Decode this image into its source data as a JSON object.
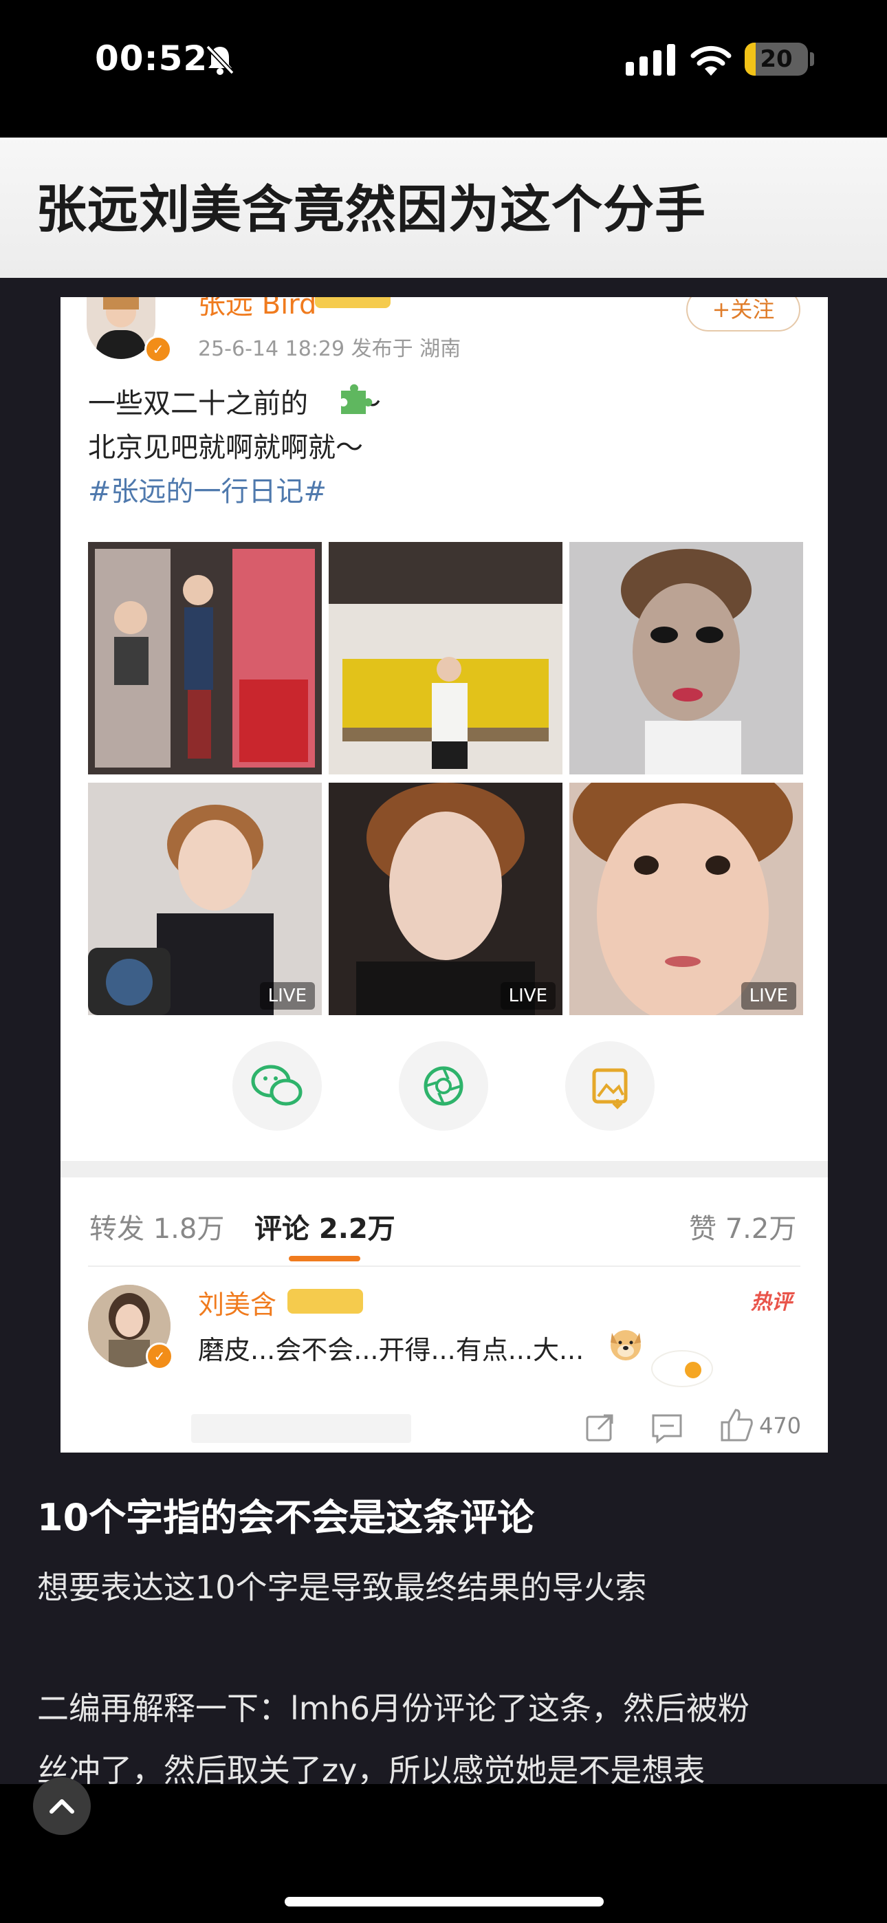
{
  "status_bar": {
    "time": "00:52",
    "battery": "20",
    "battery_level": 0.2
  },
  "page": {
    "title": "张远刘美含竟然因为这个分手"
  },
  "post": {
    "author": "张远 Bird",
    "meta": "25-6-14 18:29  发布于 湖南",
    "follow_label": "+关注",
    "line1": "一些双二十之前的",
    "line1_suffix": "～",
    "line2": "北京见吧就啊就啊就～",
    "hashtag": "#张远的一行日记#",
    "live_label": "LIVE",
    "stats": {
      "repost": "转发 1.8万",
      "comment": "评论 2.2万",
      "like": "赞 7.2万"
    }
  },
  "comment": {
    "author": "刘美含",
    "hot_label": "热评",
    "text": "磨皮...会不会...开得...有点...大...",
    "like_count": "470"
  },
  "article": {
    "heading": "10个字指的会不会是这条评论",
    "p1": "想要表达这10个字是导致最终结果的导火索",
    "p2_line1": "二编再解释一下：lmh6月份评论了这条，然后被粉",
    "p2_line2": "丝冲了，然后取关了zy，所以感觉她是不是想表"
  },
  "colors": {
    "accent_orange": "#f07b1e",
    "hashtag_blue": "#4f79ad",
    "hot_red": "#e9544a",
    "page_bg": "#1b1a22"
  },
  "icons": [
    "bell-slash-icon",
    "signal-icon",
    "wifi-icon",
    "puzzle-icon",
    "wechat-icon",
    "moments-icon",
    "save-image-icon",
    "dog-emoji-icon",
    "share-icon",
    "reply-icon",
    "like-icon",
    "chevron-up-icon"
  ]
}
